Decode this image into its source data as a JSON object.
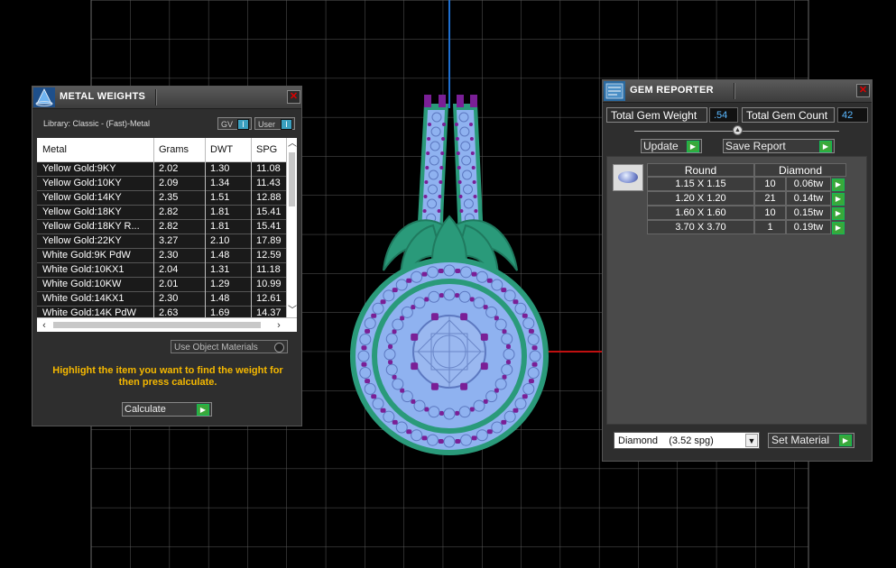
{
  "metal_weights": {
    "title": "METAL WEIGHTS",
    "library_label": "Library: Classic - (Fast)-Metal",
    "gv_label": "GV",
    "user_label": "User",
    "columns": [
      "Metal",
      "Grams",
      "DWT",
      "SPG"
    ],
    "rows": [
      {
        "metal": "Yellow Gold:9KY",
        "grams": "2.02",
        "dwt": "1.30",
        "spg": "11.08"
      },
      {
        "metal": "Yellow Gold:10KY",
        "grams": "2.09",
        "dwt": "1.34",
        "spg": "11.43"
      },
      {
        "metal": "Yellow Gold:14KY",
        "grams": "2.35",
        "dwt": "1.51",
        "spg": "12.88"
      },
      {
        "metal": "Yellow Gold:18KY",
        "grams": "2.82",
        "dwt": "1.81",
        "spg": "15.41"
      },
      {
        "metal": "Yellow Gold:18KY R...",
        "grams": "2.82",
        "dwt": "1.81",
        "spg": "15.41"
      },
      {
        "metal": "Yellow Gold:22KY",
        "grams": "3.27",
        "dwt": "2.10",
        "spg": "17.89"
      },
      {
        "metal": "White Gold:9K PdW",
        "grams": "2.30",
        "dwt": "1.48",
        "spg": "12.59"
      },
      {
        "metal": "White Gold:10KX1",
        "grams": "2.04",
        "dwt": "1.31",
        "spg": "11.18"
      },
      {
        "metal": "White Gold:10KW",
        "grams": "2.01",
        "dwt": "1.29",
        "spg": "10.99"
      },
      {
        "metal": "White Gold:14KX1",
        "grams": "2.30",
        "dwt": "1.48",
        "spg": "12.61"
      },
      {
        "metal": "White Gold:14K PdW",
        "grams": "2.63",
        "dwt": "1.69",
        "spg": "14.37"
      }
    ],
    "use_object_materials": "Use Object Materials",
    "hint": "Highlight the item you want to find the weight for then press calculate.",
    "calculate_label": "Calculate"
  },
  "gem_reporter": {
    "title": "GEM REPORTER",
    "total_weight_label": "Total Gem Weight",
    "total_weight_value": ".54",
    "total_count_label": "Total Gem Count",
    "total_count_value": "42",
    "update_label": "Update",
    "save_report_label": "Save Report",
    "columns": [
      "Round",
      "Diamond"
    ],
    "rows": [
      {
        "size": "1.15 X 1.15",
        "count": "10",
        "weight": "0.06tw"
      },
      {
        "size": "1.20 X 1.20",
        "count": "21",
        "weight": "0.14tw"
      },
      {
        "size": "1.60 X 1.60",
        "count": "10",
        "weight": "0.15tw"
      },
      {
        "size": "3.70 X 3.70",
        "count": "1",
        "weight": "0.19tw"
      }
    ],
    "material_selected": "Diamond    (3.52 spg)",
    "set_material_label": "Set Material"
  },
  "colors": {
    "hint_text": "#f5b800",
    "value_text": "#5ab8ff",
    "go_button": "#3aa83a",
    "gem_fill": "#8fb2f0",
    "prong": "#7a1f96",
    "metal_green": "#2a9a7a"
  }
}
